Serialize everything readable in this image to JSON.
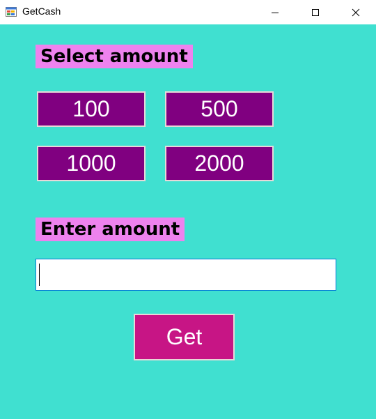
{
  "window": {
    "title": "GetCash",
    "icon": "windows-form-icon",
    "controls": [
      "minimize-icon",
      "maximize-icon",
      "close-icon"
    ]
  },
  "select_section": {
    "label": "Select amount",
    "amounts": [
      "100",
      "500",
      "1000",
      "2000"
    ]
  },
  "enter_section": {
    "label": "Enter amount",
    "value": ""
  },
  "get_button": {
    "label": "Get"
  },
  "colors": {
    "background": "#40e0d0",
    "label_bg": "#ee82ee",
    "amount_button_bg": "#800080",
    "get_button_bg": "#c71585",
    "input_border": "#0078d7"
  }
}
